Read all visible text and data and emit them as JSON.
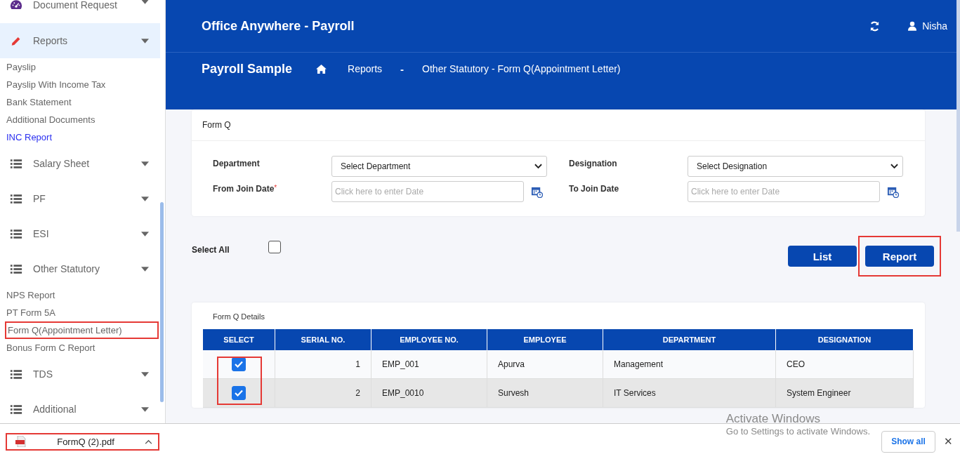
{
  "sidebar": {
    "groups": [
      {
        "kind": "gauge",
        "label": "Document Request",
        "selected": false
      },
      {
        "kind": "pencil",
        "label": "Reports",
        "selected": true,
        "children": [
          {
            "label": "Payslip",
            "active": false,
            "highlighted": false
          },
          {
            "label": "Payslip With Income Tax",
            "active": false,
            "highlighted": false
          },
          {
            "label": "Bank Statement",
            "active": false,
            "highlighted": false
          },
          {
            "label": "Additional Documents",
            "active": false,
            "highlighted": false
          },
          {
            "label": "INC Report",
            "active": true,
            "highlighted": false
          }
        ]
      },
      {
        "kind": "list",
        "label": "Salary Sheet",
        "selected": false
      },
      {
        "kind": "list",
        "label": "PF",
        "selected": false
      },
      {
        "kind": "list",
        "label": "ESI",
        "selected": false
      },
      {
        "kind": "list",
        "label": "Other Statutory",
        "selected": false,
        "children": [
          {
            "label": "NPS Report",
            "active": false,
            "highlighted": false
          },
          {
            "label": "PT Form 5A",
            "active": false,
            "highlighted": false
          },
          {
            "label": "Form Q(Appointment Letter)",
            "active": false,
            "highlighted": true
          },
          {
            "label": "Bonus Form C Report",
            "active": false,
            "highlighted": false
          }
        ]
      },
      {
        "kind": "list",
        "label": "TDS",
        "selected": false
      },
      {
        "kind": "list",
        "label": "Additional",
        "selected": false
      }
    ]
  },
  "header": {
    "app_title": "Office Anywhere - Payroll",
    "user": "Nisha",
    "company": "Payroll Sample",
    "breadcrumb": [
      "Reports",
      "Other Statutory - Form Q(Appointment Letter)"
    ],
    "breadcrumb_separator": "-"
  },
  "filter_card": {
    "title": "Form Q",
    "fields": [
      {
        "label": "Department",
        "kind": "select",
        "value": "Select Department"
      },
      {
        "label": "Designation",
        "kind": "select",
        "value": "Select Designation"
      },
      {
        "label": "From Join Date",
        "required_mark": "*",
        "kind": "date",
        "placeholder": "Click here to enter Date"
      },
      {
        "label": "To Join Date",
        "kind": "date",
        "placeholder": "Click here to enter Date"
      }
    ]
  },
  "select_all": {
    "label": "Select All",
    "checked": false
  },
  "buttons": [
    {
      "label": "List",
      "highlighted": false
    },
    {
      "label": "Report",
      "highlighted": true
    }
  ],
  "table": {
    "title": "Form Q Details",
    "columns": [
      "SELECT",
      "SERIAL NO.",
      "EMPLOYEE NO.",
      "EMPLOYEE",
      "DEPARTMENT",
      "DESIGNATION"
    ],
    "checkboxes_highlighted": true,
    "rows": [
      {
        "checked": true,
        "cells": [
          "1",
          "EMP_001",
          "Apurva",
          "Management",
          "CEO"
        ]
      },
      {
        "checked": true,
        "cells": [
          "2",
          "EMP_0010",
          "Survesh",
          "IT Services",
          "System Engineer"
        ]
      }
    ]
  },
  "download_bar": {
    "file": "FormQ (2).pdf",
    "highlighted": true,
    "show_all": "Show all",
    "close": "✕"
  },
  "os_notice": {
    "title": "Activate Windows",
    "text": "Go to Settings to activate Windows."
  }
}
